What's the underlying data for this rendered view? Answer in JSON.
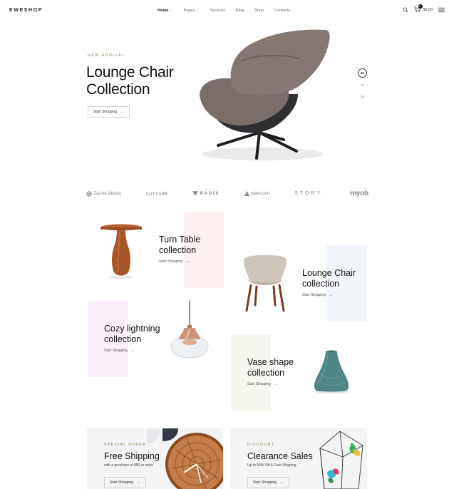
{
  "brand": {
    "logo": "EWESHOP"
  },
  "nav": [
    {
      "label": "Home",
      "dropdown": true
    },
    {
      "label": "Pages",
      "dropdown": true
    },
    {
      "label": "Services",
      "dropdown": false
    },
    {
      "label": "Blog",
      "dropdown": false
    },
    {
      "label": "Shop",
      "dropdown": false
    },
    {
      "label": "Contacts",
      "dropdown": false
    }
  ],
  "header_icons": {
    "search": "search-icon",
    "cart": "cart-icon",
    "cart_count": "0",
    "cart_total": "$0.00",
    "menu": "hamburger-icon"
  },
  "hero": {
    "eyebrow": "NEW ARRIVAL",
    "title_line1": "Lounge Chair",
    "title_line2": "Collection",
    "button": "Start Shopping",
    "slides": [
      "01",
      "02",
      "03"
    ],
    "active_slide": "01"
  },
  "brands": [
    "Zazzle Media",
    "SutroHR",
    "RADIX",
    "sylexcoin",
    "STORY.",
    "myob"
  ],
  "collections": {
    "turn_table": {
      "line1": "Turn Table",
      "line2": "collection",
      "link": "Start Shopping"
    },
    "lounge_chair": {
      "line1": "Lounge Chair",
      "line2": "collection",
      "link": "Start Shopping"
    },
    "cozy_lightning": {
      "line1": "Cozy lightning",
      "line2": "collection",
      "link": "Start Shopping"
    },
    "vase_shape": {
      "line1": "Vase shape",
      "line2": "collection",
      "link": "Start Shopping"
    }
  },
  "promos": {
    "free_shipping": {
      "eyebrow": "SPECIAL OFFER",
      "title": "Free Shipping",
      "subtitle": "with a purchase of $50 or more",
      "button": "Start Shopping"
    },
    "clearance": {
      "eyebrow": "DISCOUNT",
      "title": "Clearance Sales",
      "subtitle": "Up to 50% Off & Free Shipping",
      "button": "Start Shopping"
    }
  },
  "colors": {
    "accent_gold": "#8a7a5a",
    "pink_block": "#fdf1f2",
    "blue_block": "#f2f6fb",
    "green_block": "#f5f7ef",
    "lavender_block": "#fbf1fb"
  }
}
